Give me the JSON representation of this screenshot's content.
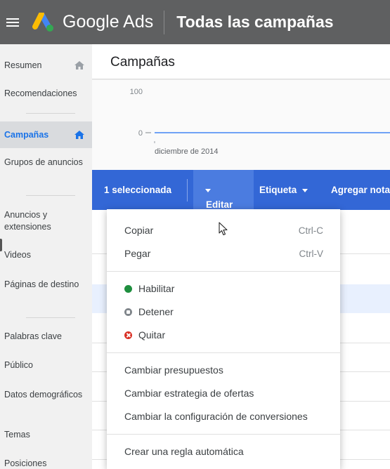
{
  "topbar": {
    "brand": "Google Ads",
    "title": "Todas las campañas",
    "menu_icon": "hamburger-menu-icon",
    "logo_icon": "google-ads-logo"
  },
  "sidebar": {
    "items": [
      {
        "label": "Resumen",
        "icon": "home-icon"
      },
      {
        "label": "Recomendaciones"
      },
      {
        "label": "Campañas",
        "icon": "home-icon",
        "active": true
      },
      {
        "label": "Grupos de anuncios"
      },
      {
        "label": "Anuncios y extensiones"
      },
      {
        "label": "Videos"
      },
      {
        "label": "Páginas de destino"
      },
      {
        "label": "Palabras clave"
      },
      {
        "label": "Público"
      },
      {
        "label": "Datos demográficos"
      },
      {
        "label": "Temas"
      },
      {
        "label": "Posiciones"
      }
    ]
  },
  "main": {
    "title": "Campañas"
  },
  "chart_data": {
    "type": "line",
    "ytick_labels": [
      "100",
      "0"
    ],
    "xtick_labels": [
      "diciembre de 2014"
    ],
    "ylim": [
      0,
      100
    ],
    "series": [
      {
        "values": [
          0
        ]
      }
    ],
    "line_color": "#4285f4"
  },
  "selection_bar": {
    "count_label": "1 seleccionada",
    "edit_label": "Editar",
    "label_label": "Etiqueta",
    "note_label": "Agregar nota"
  },
  "edit_menu": {
    "copy": {
      "label": "Copiar",
      "shortcut": "Ctrl-C"
    },
    "paste": {
      "label": "Pegar",
      "shortcut": "Ctrl-V"
    },
    "enable": "Habilitar",
    "pause": "Detener",
    "remove": "Quitar",
    "change_budgets": "Cambiar presupuestos",
    "change_bid_strategy": "Cambiar estrategia de ofertas",
    "change_conversions": "Cambiar la configuración de conversiones",
    "create_rule": "Crear una regla automática"
  },
  "colors": {
    "topbar": "#5f6061",
    "accent": "#3367d6",
    "active_nav": "#1a73e8",
    "enabled": "#1e8e3e",
    "paused": "#80868b",
    "removed": "#d93025"
  }
}
